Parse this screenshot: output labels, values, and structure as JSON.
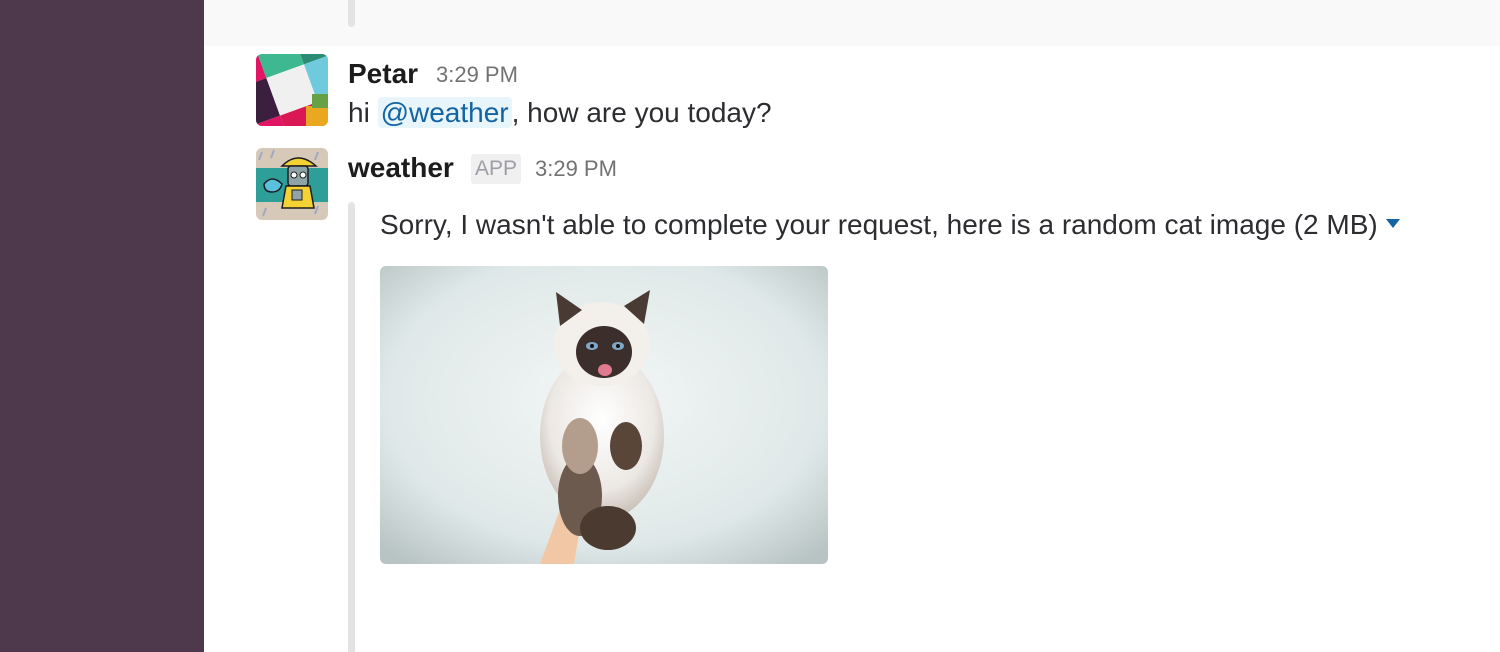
{
  "messages": [
    {
      "sender": "Petar",
      "time": "3:29 PM",
      "text_prefix": "hi ",
      "mention": "@weather",
      "text_suffix": ", how are you today?"
    },
    {
      "sender": "weather",
      "badge": "APP",
      "time": "3:29 PM",
      "attachment_text": "Sorry, I wasn't able to complete your request, here is a random cat image (2 MB)",
      "attachment_image": "cat-image"
    }
  ],
  "colors": {
    "sidebar": "#4d394b",
    "mention_bg": "#e8f5fa",
    "link": "#1264a3"
  },
  "icons": {
    "attachment_expand": "caret-down-icon"
  }
}
